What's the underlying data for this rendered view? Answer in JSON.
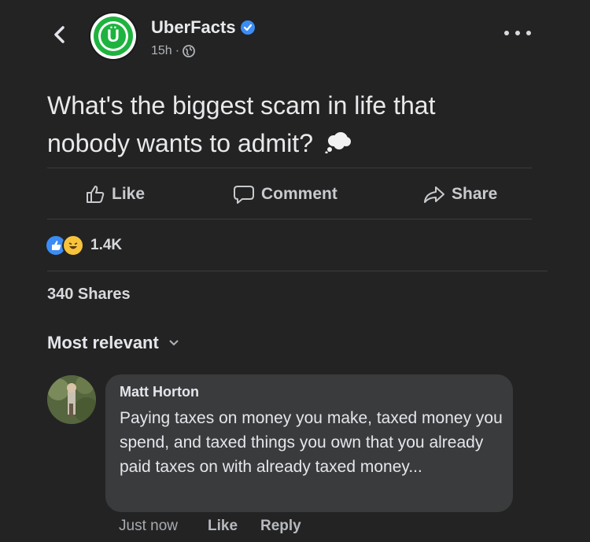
{
  "header": {
    "page_name": "UberFacts",
    "time": "15h",
    "separator": "·",
    "avatar_letter": "Ü",
    "icons": [
      "back-chevron-icon",
      "verified-badge-icon",
      "globe-icon",
      "more-dots-icon"
    ]
  },
  "post": {
    "text": "What's the biggest scam in life that nobody wants to admit?",
    "emoji_icon": "thought-bubble-icon"
  },
  "actions": {
    "like": "Like",
    "comment": "Comment",
    "share": "Share"
  },
  "stats": {
    "reaction_count": "1.4K",
    "reaction_icons": [
      "like-reaction-icon",
      "haha-reaction-icon"
    ],
    "shares": "340 Shares"
  },
  "comments": {
    "sort_label": "Most relevant",
    "items": [
      {
        "author": "Matt Horton",
        "text": "Paying taxes on money you make, taxed money you spend, and taxed things you own that you already paid taxes on with already taxed money...",
        "time": "Just now",
        "like": "Like",
        "reply": "Reply"
      }
    ]
  },
  "colors": {
    "background": "#232324",
    "bubble": "#3a3b3c",
    "accent_blue": "#3b8df5",
    "brand_green": "#1eb33f",
    "haha_yellow": "#f7c33b"
  }
}
